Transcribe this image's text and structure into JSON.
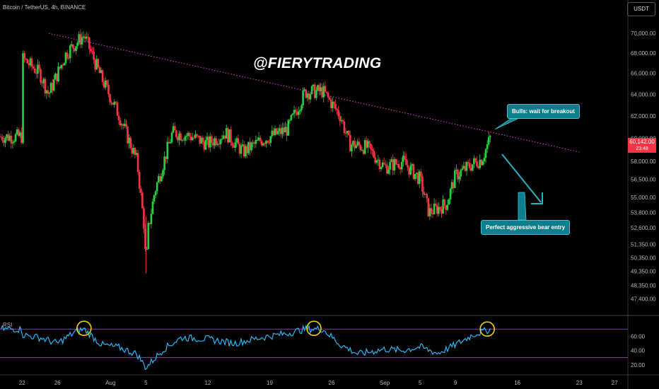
{
  "header": {
    "symbol": "Bitcoin / TetherUS, 4h, BINANCE",
    "currency": "USDT"
  },
  "watermark": "@FIERYTRADING",
  "current_price": {
    "value": "60,142.00",
    "countdown": "23:48"
  },
  "callouts": {
    "bulls": "Bulls: wait for breakout",
    "bear": "Perfect aggressive bear entry"
  },
  "colors": {
    "up": "#26d13d",
    "down": "#f23645",
    "rsi": "#29b6f6",
    "trendline": "#cc33cc",
    "rsi_band": "#cc33cc",
    "highlight": "#f0d000"
  },
  "chart_data": [
    {
      "type": "candlestick",
      "title": "Bitcoin / TetherUS, 4h, BINANCE",
      "y_ticks": [
        70000,
        68000,
        66000,
        64000,
        62000,
        60000,
        58000,
        56500,
        55000,
        53800,
        52600,
        51350,
        50350,
        49350,
        48350,
        47400
      ],
      "y_tick_labels": [
        "70,000.00",
        "68,000.00",
        "66,000.00",
        "64,000.00",
        "62,000.00",
        "60,000.00",
        "58,000.00",
        "56,500.00",
        "55,000.00",
        "53,800.00",
        "52,600.00",
        "51,350.00",
        "50,350.00",
        "49,350.00",
        "48,350.00",
        "47,400.00"
      ],
      "x_tick_labels": [
        "22",
        "26",
        "Aug",
        "5",
        "12",
        "19",
        "26",
        "Sep",
        "5",
        "9",
        "16",
        "23",
        "27"
      ],
      "scale": "log",
      "series": [
        {
          "name": "close",
          "points": [
            [
              "Jul 22",
              67500
            ],
            [
              "Jul 24",
              66000
            ],
            [
              "Jul 25",
              64000
            ],
            [
              "Jul 27",
              68000
            ],
            [
              "Jul 29",
              69800
            ],
            [
              "Jul 31",
              65500
            ],
            [
              "Aug 2",
              62000
            ],
            [
              "Aug 4",
              58000
            ],
            [
              "Aug 5",
              51500
            ],
            [
              "Aug 6",
              55500
            ],
            [
              "Aug 8",
              60500
            ],
            [
              "Aug 10",
              60200
            ],
            [
              "Aug 12",
              59500
            ],
            [
              "Aug 14",
              60500
            ],
            [
              "Aug 16",
              58800
            ],
            [
              "Aug 18",
              59800
            ],
            [
              "Aug 21",
              60800
            ],
            [
              "Aug 23",
              64200
            ],
            [
              "Aug 25",
              64300
            ],
            [
              "Aug 27",
              62000
            ],
            [
              "Aug 28",
              59500
            ],
            [
              "Aug 30",
              59200
            ],
            [
              "Sep 1",
              57500
            ],
            [
              "Sep 3",
              58000
            ],
            [
              "Sep 5",
              56500
            ],
            [
              "Sep 6",
              53800
            ],
            [
              "Sep 8",
              54500
            ],
            [
              "Sep 9",
              56800
            ],
            [
              "Sep 11",
              57800
            ],
            [
              "Sep 12",
              58200
            ],
            [
              "Sep 13",
              60142
            ]
          ]
        }
      ],
      "annotations": [
        {
          "type": "trendline",
          "from": [
            "Jul 25",
            70000
          ],
          "to": [
            "Sep 23",
            58800
          ],
          "style": "dotted"
        },
        {
          "type": "callout",
          "text": "Bulls: wait for breakout"
        },
        {
          "type": "callout",
          "text": "Perfect aggressive bear entry"
        }
      ]
    },
    {
      "type": "line",
      "title": "RSI",
      "y_ticks": [
        60,
        40,
        20
      ],
      "y_tick_labels": [
        "60.00",
        "40.00",
        "20.00"
      ],
      "bands": [
        70,
        30
      ],
      "series": [
        {
          "name": "RSI",
          "points": [
            [
              "Jul 22",
              62
            ],
            [
              "Jul 24",
              58
            ],
            [
              "Jul 26",
              50
            ],
            [
              "Jul 28",
              66
            ],
            [
              "Jul 29",
              70
            ],
            [
              "Jul 31",
              48
            ],
            [
              "Aug 2",
              44
            ],
            [
              "Aug 4",
              35
            ],
            [
              "Aug 5",
              16
            ],
            [
              "Aug 7",
              42
            ],
            [
              "Aug 9",
              58
            ],
            [
              "Aug 12",
              56
            ],
            [
              "Aug 15",
              50
            ],
            [
              "Aug 18",
              58
            ],
            [
              "Aug 21",
              64
            ],
            [
              "Aug 23",
              70
            ],
            [
              "Aug 25",
              70
            ],
            [
              "Aug 27",
              48
            ],
            [
              "Aug 29",
              35
            ],
            [
              "Sep 1",
              42
            ],
            [
              "Sep 3",
              40
            ],
            [
              "Sep 5",
              45
            ],
            [
              "Sep 7",
              36
            ],
            [
              "Sep 9",
              48
            ],
            [
              "Sep 11",
              62
            ],
            [
              "Sep 13",
              70
            ]
          ]
        }
      ],
      "highlighted_peaks": [
        "Jul 29",
        "Aug 24",
        "Sep 13"
      ]
    }
  ]
}
